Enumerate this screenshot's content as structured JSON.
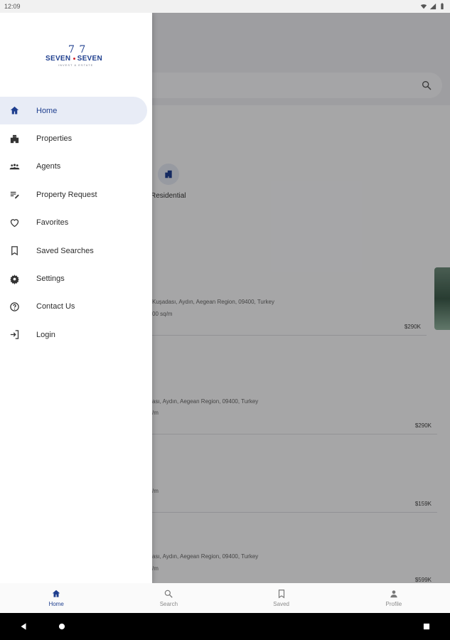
{
  "status_bar": {
    "time": "12:09"
  },
  "brand": {
    "top_mark": "7̄ 7",
    "name_left": "SEVEN",
    "name_right": "SEVEN",
    "tagline": "INVEST & ESTATE"
  },
  "drawer": {
    "items": [
      {
        "label": "Home",
        "icon": "home-icon",
        "active": true
      },
      {
        "label": "Properties",
        "icon": "building-icon",
        "active": false
      },
      {
        "label": "Agents",
        "icon": "group-icon",
        "active": false
      },
      {
        "label": "Property Request",
        "icon": "edit-list-icon",
        "active": false
      },
      {
        "label": "Favorites",
        "icon": "heart-icon",
        "active": false
      },
      {
        "label": "Saved Searches",
        "icon": "bookmark-icon",
        "active": false
      },
      {
        "label": "Settings",
        "icon": "gear-icon",
        "active": false
      },
      {
        "label": "Contact Us",
        "icon": "help-icon",
        "active": false
      },
      {
        "label": "Login",
        "icon": "login-icon",
        "active": false
      }
    ]
  },
  "background": {
    "category_label": "Residential",
    "listings": [
      {
        "address": "Kuşadası, Aydın, Aegean Region, 09400, Turkey",
        "size": "00 sq/m",
        "price": "$290K"
      },
      {
        "address": "ası, Aydın, Aegean Region, 09400, Turkey",
        "size": "/m",
        "price": "$290K"
      },
      {
        "address": "",
        "size": "/m",
        "price": "$159K"
      },
      {
        "address": "ası, Aydın, Aegean Region, 09400, Turkey",
        "size": "/m",
        "price": "$599K"
      }
    ]
  },
  "bottom_nav": {
    "items": [
      {
        "label": "Home",
        "icon": "home-icon",
        "active": true
      },
      {
        "label": "Search",
        "icon": "search-icon",
        "active": false
      },
      {
        "label": "Saved",
        "icon": "bookmark-icon",
        "active": false
      },
      {
        "label": "Profile",
        "icon": "person-icon",
        "active": false
      }
    ]
  },
  "colors": {
    "accent": "#1f3f8f",
    "active_bg": "#e8ecf6",
    "scrim": "rgba(0,0,0,0.32)"
  }
}
